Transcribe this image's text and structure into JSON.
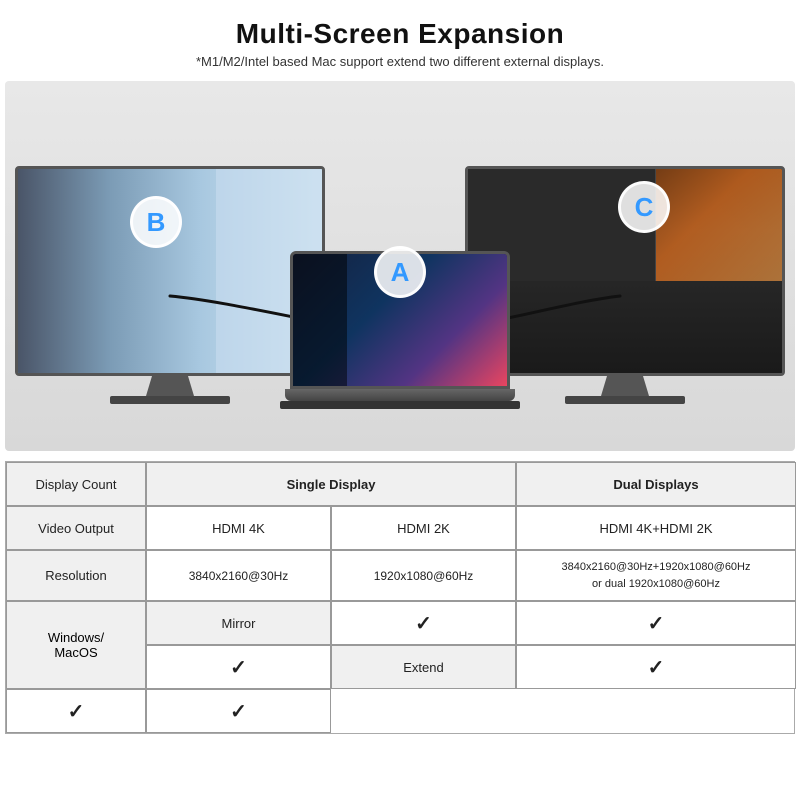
{
  "header": {
    "title": "Multi-Screen Expansion",
    "subtitle": "*M1/M2/Intel based Mac support extend two different external displays."
  },
  "badges": {
    "a": "A",
    "b": "B",
    "c": "C"
  },
  "table": {
    "rows": [
      {
        "label": "Display Count",
        "col1": "Single Display",
        "col2": "",
        "col3": "Dual Displays",
        "spanMid": true
      },
      {
        "label": "Video Output",
        "col1": "HDMI 4K",
        "col2": "HDMI 2K",
        "col3": "HDMI 4K+HDMI 2K",
        "spanMid": false
      },
      {
        "label": "Resolution",
        "col1": "3840x2160@30Hz",
        "col2": "1920x1080@60Hz",
        "col3": "3840x2160@30Hz+1920x1080@60Hz\nor dual 1920x1080@60Hz",
        "spanMid": false
      }
    ],
    "windows_macos_label": "Windows/\nMacOS",
    "mirror_label": "Mirror",
    "extend_label": "Extend",
    "checkmark": "✓"
  }
}
